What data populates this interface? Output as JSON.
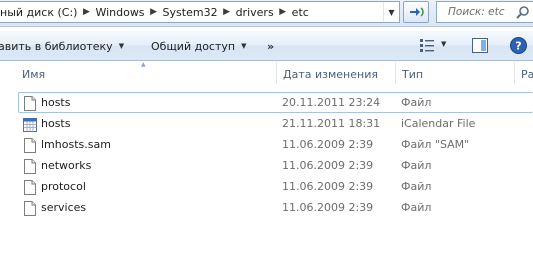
{
  "address_bar": {
    "breadcrumbs": [
      "ный диск (C:)",
      "Windows",
      "System32",
      "drivers",
      "etc"
    ]
  },
  "search": {
    "placeholder": "Поиск: etc"
  },
  "command_bar": {
    "add_to_library": "авить в библиотеку",
    "share": "Общий доступ",
    "more": "»"
  },
  "columns": {
    "name": "Имя",
    "date": "Дата изменения",
    "type": "Тип",
    "size": "Ра"
  },
  "files": [
    {
      "name": "hosts",
      "date": "20.11.2011 23:24",
      "type": "Файл",
      "icon": "file-icon"
    },
    {
      "name": "hosts",
      "date": "21.11.2011 18:31",
      "type": "iCalendar File",
      "icon": "calendar-icon"
    },
    {
      "name": "lmhosts.sam",
      "date": "11.06.2009 2:39",
      "type": "Файл \"SAM\"",
      "icon": "file-icon"
    },
    {
      "name": "networks",
      "date": "11.06.2009 2:39",
      "type": "Файл",
      "icon": "file-icon"
    },
    {
      "name": "protocol",
      "date": "11.06.2009 2:39",
      "type": "Файл",
      "icon": "file-icon"
    },
    {
      "name": "services",
      "date": "11.06.2009 2:39",
      "type": "Файл",
      "icon": "file-icon"
    }
  ]
}
